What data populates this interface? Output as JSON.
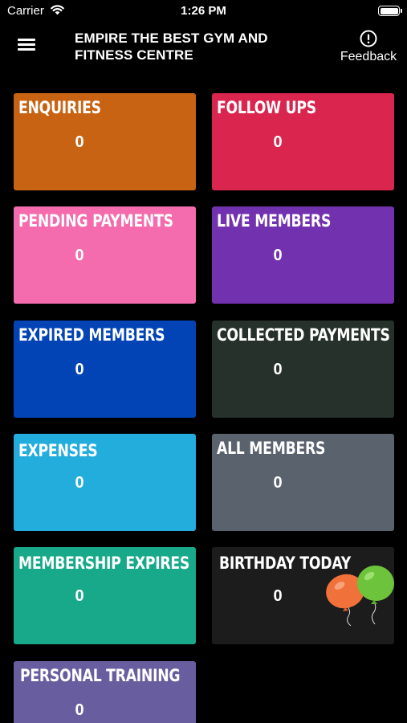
{
  "status_bar": {
    "carrier": "Carrier",
    "time": "1:26 PM",
    "battery_level": 1.0
  },
  "header": {
    "menu_icon": "hamburger-menu-icon",
    "title": "EMPIRE THE BEST GYM AND FITNESS CENTRE",
    "feedback_icon": "exclamation-circle-icon",
    "feedback_label": "Feedback"
  },
  "tiles": [
    {
      "label": "ENQUIRIES",
      "count": "0",
      "color": "#C76313"
    },
    {
      "label": "FOLLOW UPS",
      "count": "0",
      "color": "#DA254E"
    },
    {
      "label": "PENDING PAYMENTS",
      "count": "0",
      "color": "#F46BAE"
    },
    {
      "label": "LIVE MEMBERS",
      "count": "0",
      "color": "#7231AE"
    },
    {
      "label": "EXPIRED MEMBERS",
      "count": "0",
      "color": "#0244B6"
    },
    {
      "label": "COLLECTED PAYMENTS",
      "count": "0",
      "color": "#26312B"
    },
    {
      "label": "EXPENSES",
      "count": "0",
      "color": "#22ADDD"
    },
    {
      "label": "ALL MEMBERS",
      "count": "0",
      "color": "#59626D"
    },
    {
      "label": "MEMBERSHIP EXPIRES",
      "count": "0",
      "color": "#17A98A"
    },
    {
      "label": "BIRTHDAY TODAY",
      "count": "0",
      "color": "#1C1C1C",
      "icon": "balloons-icon"
    },
    {
      "label": "PERSONAL TRAINING",
      "count": "0",
      "color": "#685E9F"
    }
  ]
}
